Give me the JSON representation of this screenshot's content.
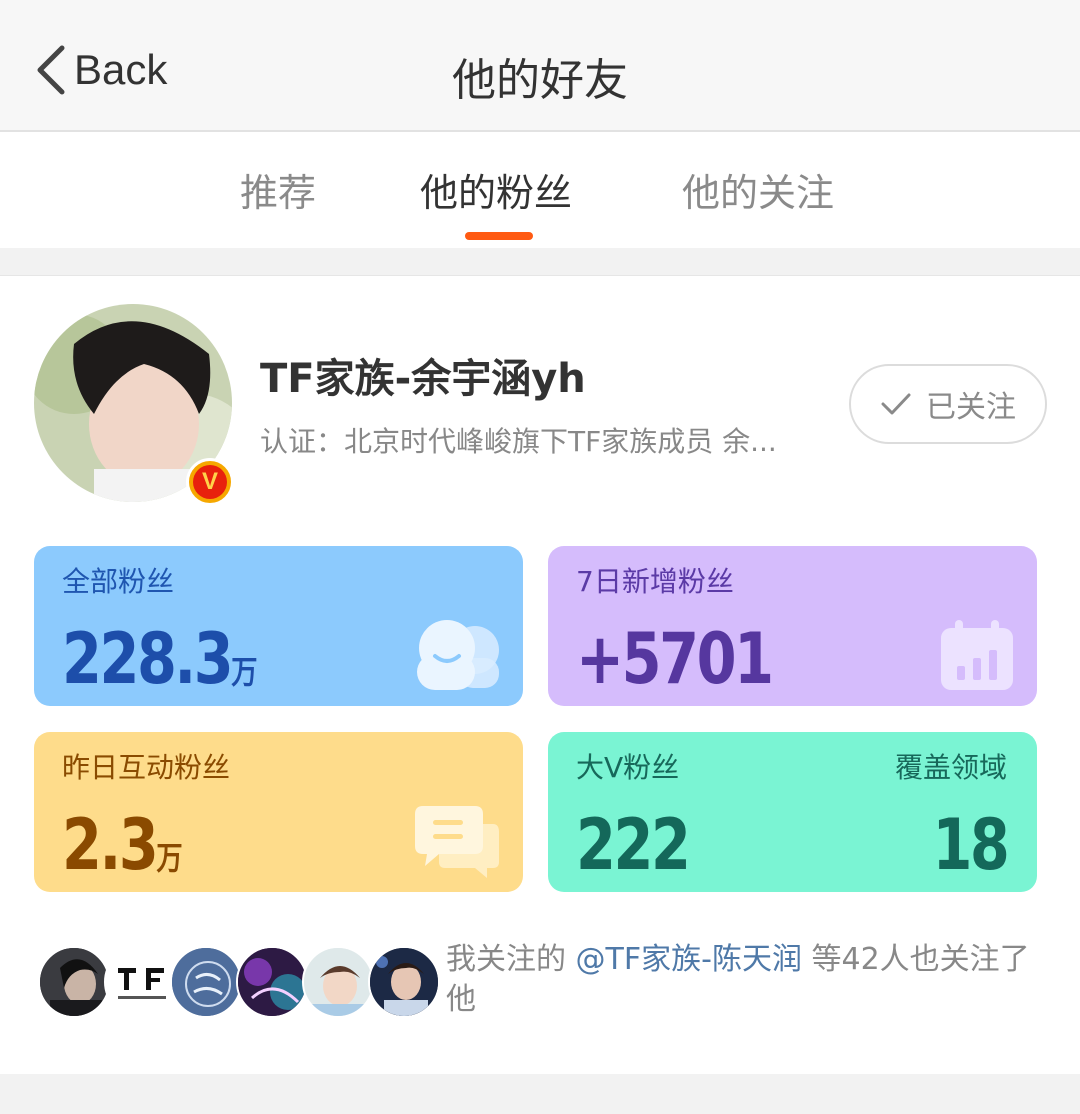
{
  "header": {
    "back_label": "Back",
    "title": "他的好友"
  },
  "tabs": [
    {
      "label": "推荐",
      "active": false
    },
    {
      "label": "他的粉丝",
      "active": true
    },
    {
      "label": "他的关注",
      "active": false
    }
  ],
  "profile": {
    "name": "TF家族-余宇涵yh",
    "verification": "认证：北京时代峰峻旗下TF家族成员 余...",
    "badge": "V",
    "follow_label": "已关注"
  },
  "stats": {
    "total_fans": {
      "label": "全部粉丝",
      "value": "228.3",
      "unit": "万"
    },
    "new_fans_7d": {
      "label": "7日新增粉丝",
      "value": "+5701"
    },
    "interactive_fans_yesterday": {
      "label": "昨日互动粉丝",
      "value": "2.3",
      "unit": "万"
    },
    "bigv_fans": {
      "label": "大V粉丝",
      "value": "222",
      "coverage_label": "覆盖领域",
      "coverage_value": "18"
    }
  },
  "mutual": {
    "prefix": "我关注的 ",
    "mention": "@TF家族-陈天润",
    "suffix": " 等42人也关注了他",
    "avatar_count": 6
  },
  "colors": {
    "accent": "#ff5a12",
    "card_total": "#8ccafd",
    "card_new": "#d5bcfc",
    "card_interactive": "#fedc8b",
    "card_bigv": "#7af4d3",
    "mention": "#4f79a8"
  }
}
